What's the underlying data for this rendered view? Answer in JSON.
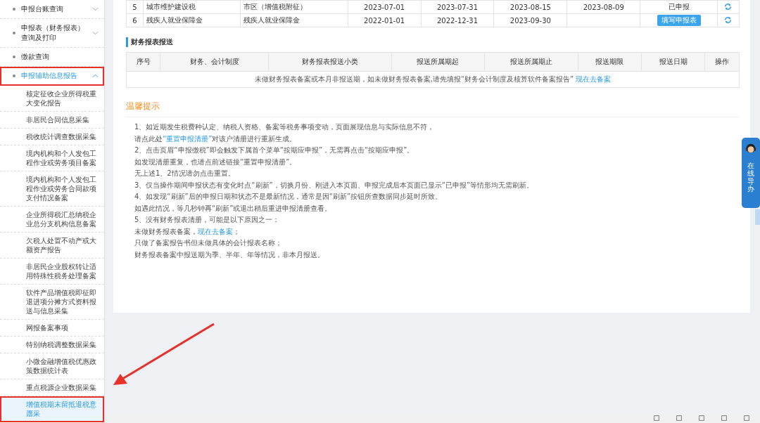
{
  "sidebar": {
    "items": [
      {
        "label": "申报台账查询",
        "expanded": false,
        "highlighted": false
      },
      {
        "label": "申报表（财务报表）查询及打印",
        "expanded": false,
        "highlighted": false
      },
      {
        "label": "缴款查询",
        "highlighted": false
      },
      {
        "label": "申报辅助信息报告",
        "expanded": true,
        "highlighted": true,
        "children": [
          {
            "label": "核定征收企业所得税重大变化报告",
            "selected": false,
            "highlighted": false
          },
          {
            "label": "非居民合同信息采集",
            "selected": false,
            "highlighted": false
          },
          {
            "label": "税收统计调查数据采集",
            "selected": false,
            "highlighted": false
          },
          {
            "label": "境内机构和个人发包工程作业或劳务项目备案",
            "selected": false,
            "highlighted": false
          },
          {
            "label": "境内机构和个人发包工程作业或劳务合同款项支付情况备案",
            "selected": false,
            "highlighted": false
          },
          {
            "label": "企业所得税汇总纳税企业总分支机构信息备案",
            "selected": false,
            "highlighted": false
          },
          {
            "label": "欠税人处置不动产或大额资产报告",
            "selected": false,
            "highlighted": false
          },
          {
            "label": "非居民企业股权转让适用特殊性税务处理备案",
            "selected": false,
            "highlighted": false
          },
          {
            "label": "软件产品增值税即征即退进项分摊方式资料报送与信息采集",
            "selected": false,
            "highlighted": false
          },
          {
            "label": "网报备案事项",
            "selected": false,
            "highlighted": false
          },
          {
            "label": "特别纳税调整数据采集",
            "selected": false,
            "highlighted": false
          },
          {
            "label": "小微金融增值税优惠政策数据统计表",
            "selected": false,
            "highlighted": false
          },
          {
            "label": "重点税源企业数据采集",
            "selected": false,
            "highlighted": false
          },
          {
            "label": "增值税期末留抵退税意愿采",
            "selected": true,
            "highlighted": true
          }
        ]
      }
    ]
  },
  "tax_table": {
    "rows": [
      {
        "cells": [
          "5",
          "城市维护建设税",
          "市区（增值税附征）",
          "2023-07-01",
          "2023-07-31",
          "2023-08-15",
          "2023-08-09"
        ],
        "status": "已申报",
        "kind": "text"
      },
      {
        "cells": [
          "6",
          "残疾人就业保障金",
          "残疾人就业保障金",
          "2022-01-01",
          "2022-12-31",
          "2023-09-30",
          ""
        ],
        "status": "填写申报表",
        "kind": "button"
      }
    ]
  },
  "report_section": {
    "title": "财务报表报送",
    "columns": [
      "序号",
      "财务、会计制度",
      "财务报表报送小类",
      "报送所属期起",
      "报送所属期止",
      "报送期限",
      "报送日期",
      "操作"
    ],
    "empty_message": "未做财务报表备案或本月非报送期，如未做财务报表备案,请先填报“财务会计制度及核算软件备案报告”",
    "empty_link": "现在去备案"
  },
  "tips": {
    "title": "温馨提示",
    "lines": [
      [
        {
          "text": "1、如近期发生税费种认定、纳税人资格、备案等税务事项变动，页面展现信息与实际信息不符，",
          "link": false
        }
      ],
      [
        {
          "text": "请点此处",
          "link": false
        },
        {
          "text": "“重置申报清册”",
          "link": true
        },
        {
          "text": "对该户清册进行重新生成。",
          "link": false
        }
      ],
      [
        {
          "text": "2、点击页眉“申报缴税”即会触发下属首个菜单“按期应申报”，无需再点击“按期应申报”。",
          "link": false
        }
      ],
      [
        {
          "text": "如发现清册重复，也请点前述链接“重置申报清册”。",
          "link": false
        }
      ],
      [
        {
          "text": "无上述1、2情况请勿点击重置。",
          "link": false
        }
      ],
      [
        {
          "text": "3、仅当操作期间申报状态有变化时点“刷新”，切换月份、刚进入本页面、申报完成后本页面已显示“已申报”等情形均无需刷新。",
          "link": false
        }
      ],
      [
        {
          "text": "4、如发现“刷新”后的申报日期和状态不是最新情况，通常是因“刷新”按钮所查数据同步延时所致。",
          "link": false
        }
      ],
      [
        {
          "text": "如遇此情况，等几秒钟再“刷新”或退出稍后重进申报清册查看。",
          "link": false
        }
      ],
      [
        {
          "text": "5、没有财务报表清册，可能是以下原因之一：",
          "link": false
        }
      ],
      [
        {
          "text": "未做财务报表备案，",
          "link": false
        },
        {
          "text": "现在去备案",
          "link": true
        },
        {
          "text": "；",
          "link": false
        }
      ],
      [
        {
          "text": "只做了备案报告书但未做具体的会计报表名称；",
          "link": false
        }
      ],
      [
        {
          "text": "财务报表备案中报送期为季、半年、年等情况，非本月报送。",
          "link": false
        }
      ]
    ]
  },
  "guide_widget": {
    "label": "在线导办"
  }
}
